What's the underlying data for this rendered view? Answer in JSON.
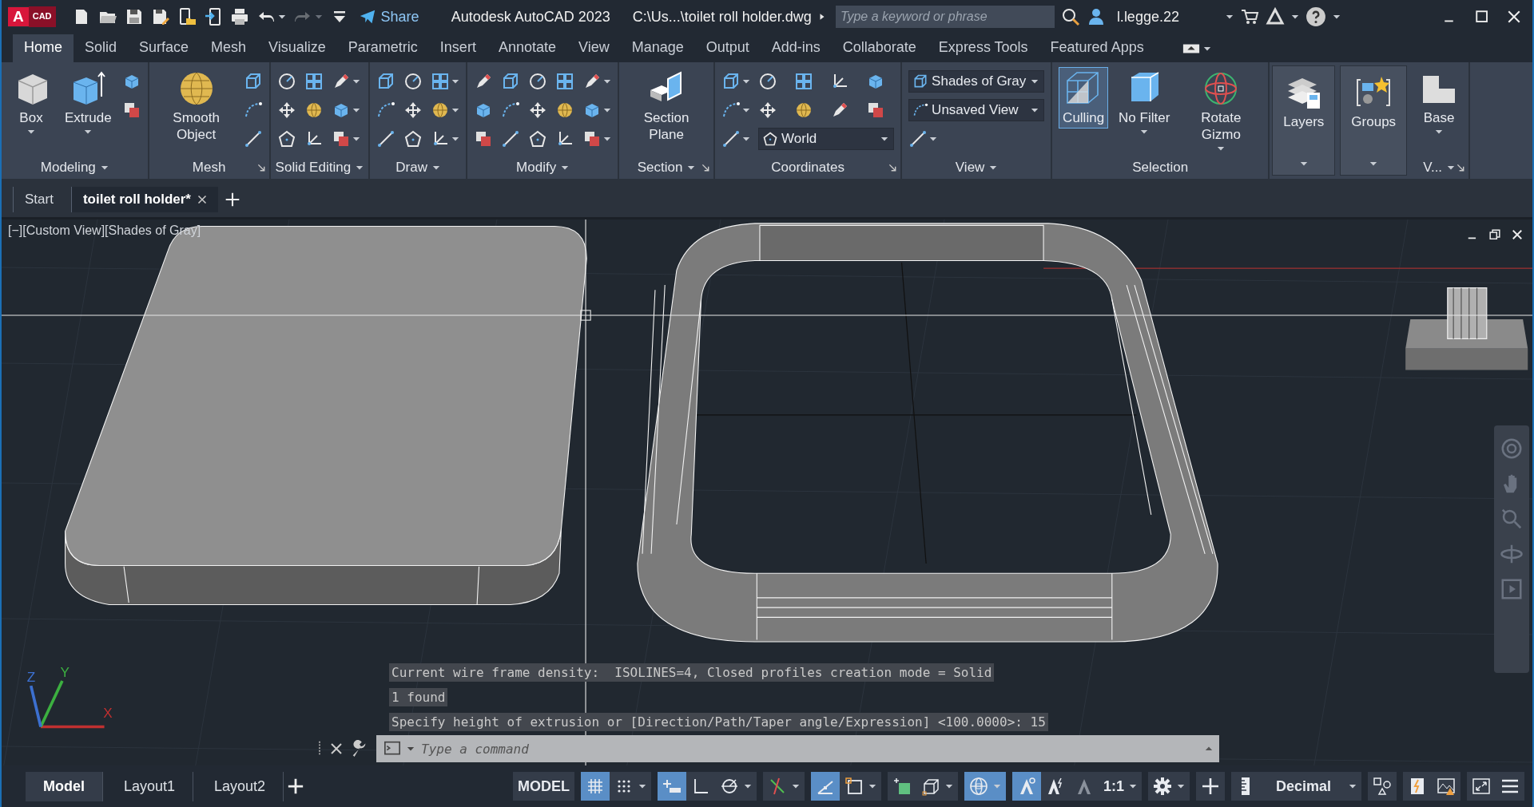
{
  "title_bar": {
    "app_badge": {
      "letter": "A",
      "label": "CAD"
    },
    "quick_access": [
      {
        "kind": "new",
        "menu": false,
        "disabled": false
      },
      {
        "kind": "open",
        "menu": false,
        "disabled": false
      },
      {
        "kind": "save",
        "menu": false,
        "disabled": false
      },
      {
        "kind": "save_as",
        "menu": false,
        "disabled": false
      },
      {
        "kind": "open_web",
        "menu": false,
        "disabled": false
      },
      {
        "kind": "send",
        "menu": false,
        "disabled": false
      },
      {
        "kind": "print",
        "menu": false,
        "disabled": false
      },
      {
        "kind": "undo",
        "menu": true,
        "disabled": false
      },
      {
        "kind": "redo",
        "menu": true,
        "disabled": true
      },
      {
        "kind": "customize",
        "menu": false,
        "disabled": false
      }
    ],
    "share": "Share",
    "app_title": "Autodesk AutoCAD 2023",
    "file_path": "C:\\Us...\\toilet roll holder.dwg",
    "search": {
      "placeholder": "Type a keyword or phrase"
    },
    "user": "l.legge.22"
  },
  "ribbon_tabs": [
    {
      "label": "Home",
      "selected": true
    },
    {
      "label": "Solid",
      "selected": false
    },
    {
      "label": "Surface",
      "selected": false
    },
    {
      "label": "Mesh",
      "selected": false
    },
    {
      "label": "Visualize",
      "selected": false
    },
    {
      "label": "Parametric",
      "selected": false
    },
    {
      "label": "Insert",
      "selected": false
    },
    {
      "label": "Annotate",
      "selected": false
    },
    {
      "label": "View",
      "selected": false
    },
    {
      "label": "Manage",
      "selected": false
    },
    {
      "label": "Output",
      "selected": false
    },
    {
      "label": "Add-ins",
      "selected": false
    },
    {
      "label": "Collaborate",
      "selected": false
    },
    {
      "label": "Express Tools",
      "selected": false
    },
    {
      "label": "Featured Apps",
      "selected": false
    }
  ],
  "ribbon_panels": [
    {
      "title": "Modeling",
      "menu": true,
      "launcher": false,
      "collapsed": false,
      "tools": [
        {
          "kind": "large",
          "label": "Box",
          "menu": true
        },
        {
          "kind": "large",
          "label": "Extrude",
          "menu": true
        },
        {
          "kind": "small",
          "menu": false
        },
        {
          "kind": "small",
          "menu": false
        }
      ]
    },
    {
      "title": "Mesh",
      "menu": false,
      "launcher": true,
      "collapsed": false,
      "tools": [
        {
          "kind": "large",
          "label": "Smooth Object",
          "menu": false
        },
        {
          "kind": "small",
          "menu": false
        },
        {
          "kind": "small",
          "menu": false
        },
        {
          "kind": "small",
          "menu": false
        }
      ]
    },
    {
      "title": "Solid Editing",
      "menu": true,
      "launcher": false,
      "collapsed": false,
      "tools": [
        {
          "kind": "small",
          "menu": false
        },
        {
          "kind": "small",
          "menu": false
        },
        {
          "kind": "small",
          "menu": false
        },
        {
          "kind": "small",
          "menu": false
        },
        {
          "kind": "small",
          "menu": false
        },
        {
          "kind": "small",
          "menu": false
        },
        {
          "kind": "small",
          "menu": true
        },
        {
          "kind": "small",
          "menu": true
        },
        {
          "kind": "small",
          "menu": true
        }
      ]
    },
    {
      "title": "Draw",
      "menu": true,
      "launcher": false,
      "collapsed": false,
      "tools": [
        {
          "kind": "small",
          "menu": false
        },
        {
          "kind": "small",
          "menu": false
        },
        {
          "kind": "small",
          "menu": false
        },
        {
          "kind": "small",
          "menu": false
        },
        {
          "kind": "small",
          "menu": false
        },
        {
          "kind": "small",
          "menu": false
        },
        {
          "kind": "small",
          "menu": true
        },
        {
          "kind": "small",
          "menu": true
        },
        {
          "kind": "small",
          "menu": true
        }
      ]
    },
    {
      "title": "Modify",
      "menu": true,
      "launcher": false,
      "collapsed": false,
      "tools": [
        {
          "kind": "small",
          "menu": false
        },
        {
          "kind": "small",
          "menu": false
        },
        {
          "kind": "small",
          "menu": false
        },
        {
          "kind": "small",
          "menu": false
        },
        {
          "kind": "small",
          "menu": false
        },
        {
          "kind": "small",
          "menu": false
        },
        {
          "kind": "small",
          "menu": false
        },
        {
          "kind": "small",
          "menu": false
        },
        {
          "kind": "small",
          "menu": false
        },
        {
          "kind": "small",
          "menu": false
        },
        {
          "kind": "small",
          "menu": false
        },
        {
          "kind": "small",
          "menu": false
        },
        {
          "kind": "small",
          "menu": true
        },
        {
          "kind": "small",
          "menu": true
        },
        {
          "kind": "small",
          "menu": true
        }
      ]
    },
    {
      "title": "Section",
      "menu": true,
      "launcher": true,
      "collapsed": false,
      "tools": [
        {
          "kind": "large",
          "label": "Section Plane",
          "menu": false
        }
      ]
    },
    {
      "title": "Coordinates",
      "menu": false,
      "launcher": true,
      "collapsed": false,
      "tools": [
        {
          "kind": "small",
          "menu": true
        },
        {
          "kind": "small",
          "menu": true
        },
        {
          "kind": "small",
          "menu": true
        },
        {
          "kind": "small",
          "menu": false
        },
        {
          "kind": "small",
          "menu": false
        },
        {
          "kind": "combo",
          "label": "World"
        },
        {
          "kind": "small",
          "menu": false
        },
        {
          "kind": "small",
          "menu": false
        },
        {
          "kind": "small",
          "menu": false
        },
        {
          "kind": "small",
          "menu": false
        },
        {
          "kind": "small",
          "menu": false
        },
        {
          "kind": "small",
          "menu": false
        }
      ]
    },
    {
      "title": "View",
      "menu": true,
      "launcher": false,
      "collapsed": false,
      "tools": [
        {
          "kind": "combo",
          "label": "Shades of Gray"
        },
        {
          "kind": "combo",
          "label": "Unsaved View"
        },
        {
          "kind": "small",
          "menu": true
        }
      ]
    },
    {
      "title": "Selection",
      "menu": false,
      "launcher": false,
      "collapsed": false,
      "tools": [
        {
          "kind": "toggle",
          "label": "Culling",
          "on": true
        },
        {
          "kind": "large",
          "label": "No Filter",
          "menu": true
        },
        {
          "kind": "large",
          "label": "Rotate Gizmo",
          "menu": true
        }
      ]
    },
    {
      "menu": true,
      "launcher": false,
      "collapsed": true,
      "tools": [
        {
          "kind": "large",
          "label": "Layers",
          "menu": false
        }
      ]
    },
    {
      "menu": true,
      "launcher": false,
      "collapsed": true,
      "tools": [
        {
          "kind": "large",
          "label": "Groups",
          "menu": false
        }
      ]
    },
    {
      "title": "V...",
      "menu": true,
      "launcher": true,
      "collapsed": false,
      "tools": [
        {
          "kind": "large",
          "label": "Base",
          "menu": true
        }
      ]
    }
  ],
  "doc_tabs": [
    {
      "label": "Start",
      "selected": false,
      "closable": false
    },
    {
      "label": "toilet roll holder*",
      "selected": true,
      "closable": true
    }
  ],
  "viewport": {
    "controls": "[−][Custom View][Shades of Gray]",
    "ucs": {
      "x": "X",
      "y": "Y",
      "z": "Z"
    },
    "command_history": [
      "Current wire frame density:  ISOLINES=4, Closed profiles creation mode = Solid",
      "1 found",
      "Specify height of extrusion or [Direction/Path/Taper angle/Expression] <100.0000>: 15"
    ],
    "command_line": {
      "placeholder": "Type a command"
    }
  },
  "status_bar": {
    "layout_tabs": [
      {
        "label": "Model",
        "selected": true
      },
      {
        "label": "Layout1",
        "selected": false
      },
      {
        "label": "Layout2",
        "selected": false
      }
    ],
    "groups": [
      [
        {
          "kind": "text",
          "label": "MODEL",
          "on": false,
          "menu": false
        }
      ],
      [
        {
          "kind": "grid",
          "on": true,
          "menu": false
        },
        {
          "kind": "snap",
          "on": false,
          "menu": true
        }
      ],
      [
        {
          "kind": "infer",
          "on": true,
          "menu": false
        },
        {
          "kind": "ortho",
          "on": false,
          "menu": false
        },
        {
          "kind": "polar",
          "on": false,
          "menu": true
        }
      ],
      [
        {
          "kind": "iso",
          "on": false,
          "menu": true
        }
      ],
      [
        {
          "kind": "track",
          "on": true,
          "menu": false
        },
        {
          "kind": "osnap",
          "on": false,
          "menu": true
        }
      ],
      [
        {
          "kind": "transparency",
          "on": false,
          "menu": false
        },
        {
          "kind": "cycling",
          "on": false,
          "menu": true
        }
      ],
      [
        {
          "kind": "globe",
          "on": true,
          "menu": true
        }
      ],
      [
        {
          "kind": "annovis",
          "on": true,
          "menu": false
        },
        {
          "kind": "autoscale",
          "on": false,
          "menu": false
        },
        {
          "kind": "annoscale",
          "on": false,
          "menu": false
        },
        {
          "kind": "text",
          "label": "1:1",
          "on": false,
          "menu": true
        }
      ],
      [
        {
          "kind": "gear",
          "on": false,
          "menu": true
        }
      ],
      [
        {
          "kind": "plus",
          "on": false,
          "menu": false
        }
      ],
      [
        {
          "kind": "units",
          "label": "Decimal",
          "on": false,
          "menu": true
        }
      ],
      [
        {
          "kind": "qp",
          "on": false,
          "menu": false
        }
      ],
      [
        {
          "kind": "lock",
          "on": false,
          "menu": false
        },
        {
          "kind": "isolate",
          "on": false,
          "menu": false
        }
      ],
      [
        {
          "kind": "fullscreen",
          "on": false,
          "menu": false
        },
        {
          "kind": "customize",
          "on": false,
          "menu": false
        }
      ]
    ]
  }
}
